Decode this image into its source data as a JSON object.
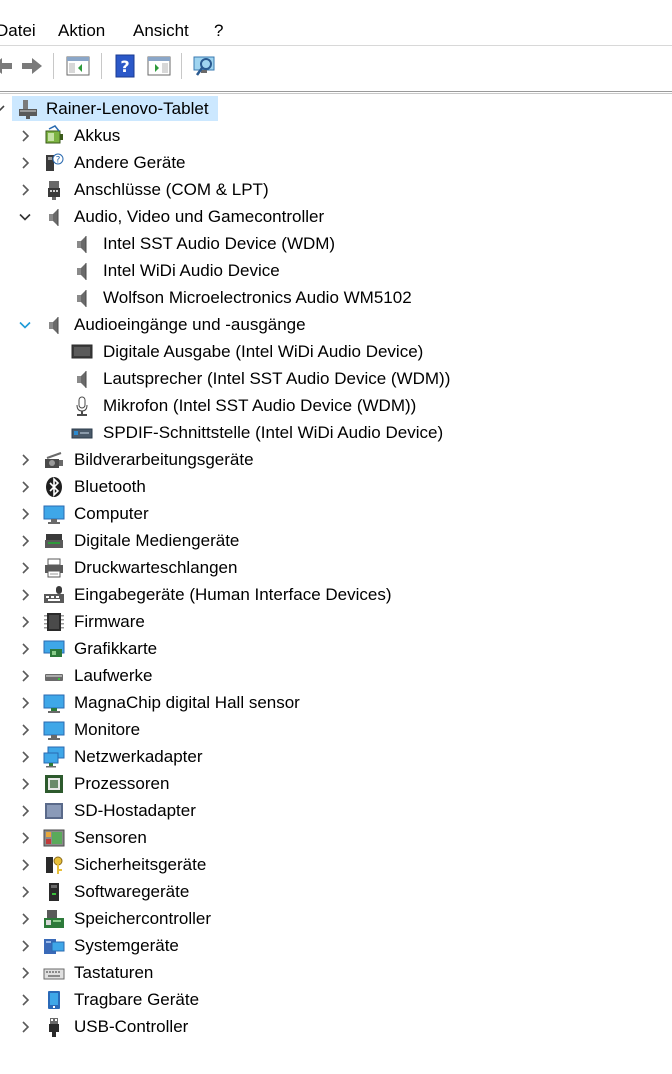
{
  "menubar": {
    "items": [
      "Datei",
      "Aktion",
      "Ansicht",
      "?"
    ]
  },
  "toolbar": {
    "buttons": [
      "back-arrow",
      "forward-arrow",
      "show-hide-console-tree",
      "help",
      "show-hide-action-pane",
      "scan-hardware"
    ]
  },
  "tree": {
    "root": "Rainer-Lenovo-Tablet",
    "categories": [
      {
        "label": "Akkus",
        "icon": "battery-icon",
        "expanded": false
      },
      {
        "label": "Andere Geräte",
        "icon": "unknown-device-icon",
        "expanded": false
      },
      {
        "label": "Anschlüsse (COM & LPT)",
        "icon": "port-icon",
        "expanded": false
      },
      {
        "label": "Audio, Video und Gamecontroller",
        "icon": "speaker-icon",
        "expanded": true,
        "children": [
          {
            "label": "Intel SST Audio Device (WDM)",
            "icon": "speaker-icon"
          },
          {
            "label": "Intel WiDi Audio Device",
            "icon": "speaker-icon"
          },
          {
            "label": "Wolfson Microelectronics Audio WM5102",
            "icon": "speaker-icon"
          }
        ]
      },
      {
        "label": "Audioeingänge und -ausgänge",
        "icon": "speaker-icon",
        "expanded": true,
        "children": [
          {
            "label": "Digitale Ausgabe (Intel WiDi Audio Device)",
            "icon": "display-output-icon"
          },
          {
            "label": "Lautsprecher (Intel SST Audio Device (WDM))",
            "icon": "speaker-icon"
          },
          {
            "label": "Mikrofon (Intel SST Audio Device (WDM))",
            "icon": "microphone-icon"
          },
          {
            "label": "SPDIF-Schnittstelle (Intel WiDi Audio Device)",
            "icon": "spdif-icon"
          }
        ]
      },
      {
        "label": "Bildverarbeitungsgeräte",
        "icon": "camera-icon",
        "expanded": false
      },
      {
        "label": "Bluetooth",
        "icon": "bluetooth-icon",
        "expanded": false
      },
      {
        "label": "Computer",
        "icon": "computer-icon",
        "expanded": false
      },
      {
        "label": "Digitale Mediengeräte",
        "icon": "media-device-icon",
        "expanded": false
      },
      {
        "label": "Druckwarteschlangen",
        "icon": "printer-icon",
        "expanded": false
      },
      {
        "label": "Eingabegeräte (Human Interface Devices)",
        "icon": "hid-icon",
        "expanded": false
      },
      {
        "label": "Firmware",
        "icon": "chip-icon",
        "expanded": false
      },
      {
        "label": "Grafikkarte",
        "icon": "graphics-card-icon",
        "expanded": false
      },
      {
        "label": "Laufwerke",
        "icon": "drive-icon",
        "expanded": false
      },
      {
        "label": "MagnaChip digital Hall sensor",
        "icon": "sensor-monitor-icon",
        "expanded": false
      },
      {
        "label": "Monitore",
        "icon": "monitor-icon",
        "expanded": false
      },
      {
        "label": "Netzwerkadapter",
        "icon": "network-icon",
        "expanded": false
      },
      {
        "label": "Prozessoren",
        "icon": "processor-icon",
        "expanded": false
      },
      {
        "label": "SD-Hostadapter",
        "icon": "sd-host-icon",
        "expanded": false
      },
      {
        "label": "Sensoren",
        "icon": "sensors-icon",
        "expanded": false
      },
      {
        "label": "Sicherheitsgeräte",
        "icon": "security-key-icon",
        "expanded": false
      },
      {
        "label": "Softwaregeräte",
        "icon": "software-device-icon",
        "expanded": false
      },
      {
        "label": "Speichercontroller",
        "icon": "storage-controller-icon",
        "expanded": false
      },
      {
        "label": "Systemgeräte",
        "icon": "system-devices-icon",
        "expanded": false
      },
      {
        "label": "Tastaturen",
        "icon": "keyboard-icon",
        "expanded": false
      },
      {
        "label": "Tragbare Geräte",
        "icon": "portable-device-icon",
        "expanded": false
      },
      {
        "label": "USB-Controller",
        "icon": "usb-icon",
        "expanded": false
      }
    ]
  },
  "colors": {
    "selection": "#cce8ff",
    "chevron": "#5a5a5a",
    "chevron_accent": "#1e9bd7"
  }
}
